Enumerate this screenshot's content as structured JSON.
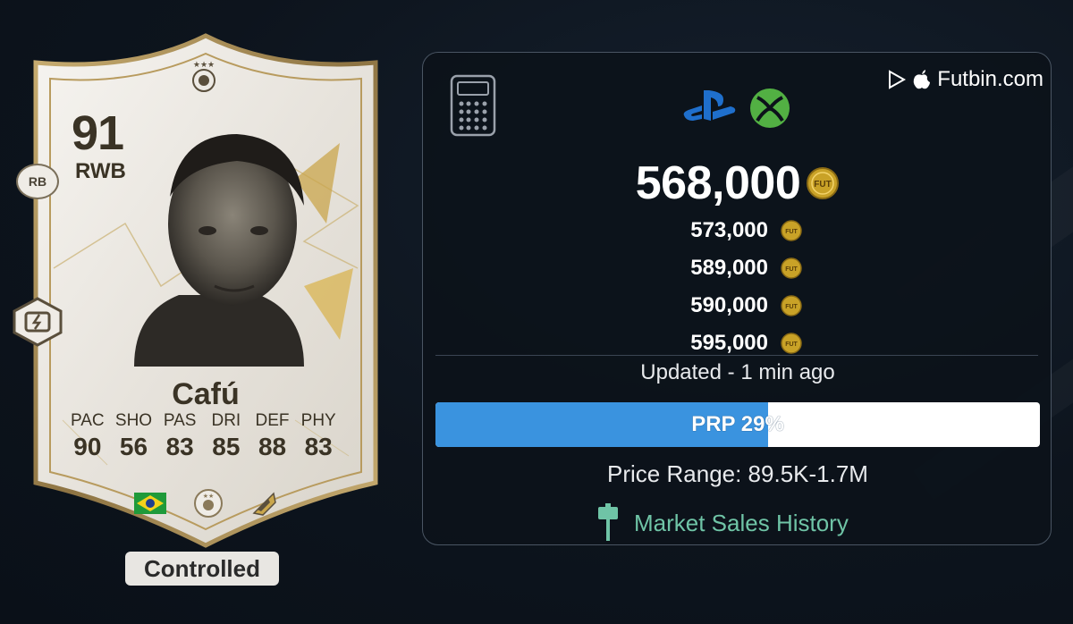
{
  "card": {
    "rating": "91",
    "position": "RWB",
    "alt_position": "RB",
    "name": "Cafú",
    "stats": [
      {
        "label": "PAC",
        "value": "90"
      },
      {
        "label": "SHO",
        "value": "56"
      },
      {
        "label": "PAS",
        "value": "83"
      },
      {
        "label": "DRI",
        "value": "85"
      },
      {
        "label": "DEF",
        "value": "88"
      },
      {
        "label": "PHY",
        "value": "83"
      }
    ],
    "icons": [
      "brazil-flag-icon",
      "icons-club-badge-icon",
      "icon-league-icon"
    ],
    "status_label": "Controlled"
  },
  "panel": {
    "brand": "Futbin.com",
    "platforms": [
      "playstation-icon",
      "xbox-icon"
    ],
    "main_price": "568,000",
    "coin_label": "FUT",
    "prices": [
      "573,000",
      "589,000",
      "590,000",
      "595,000"
    ],
    "updated": "Updated - 1 min ago",
    "prp": {
      "label": "PRP 29%",
      "fraction": 0.55
    },
    "price_range": "Price Range: 89.5K-1.7M",
    "market_history": "Market Sales History"
  },
  "colors": {
    "accent_blue": "#3a93df",
    "market_green": "#6fc4a6",
    "coin_gold": "#c9a227",
    "xbox_green": "#52b043",
    "ps_blue": "#1f6fcc"
  }
}
